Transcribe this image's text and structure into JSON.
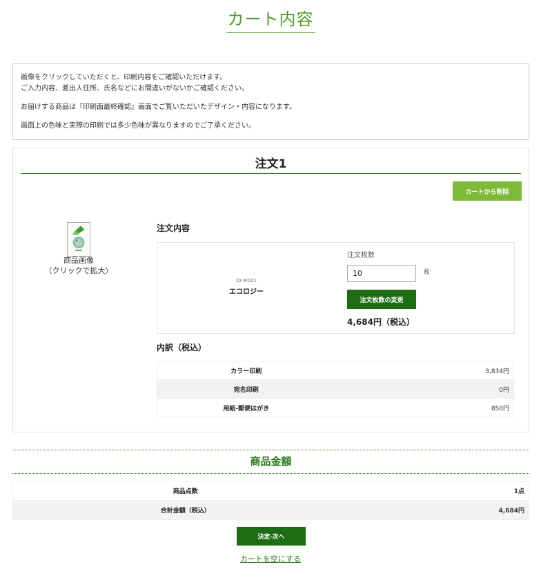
{
  "page": {
    "title": "カート内容"
  },
  "notice": {
    "line1": "画像をクリックしていただくと、印刷内容をご確認いただけます。",
    "line2": "ご入力内容、差出人住所、氏名などにお間違いがないかご確認ください。",
    "line3": "お届けする商品は『印刷面最終確認』画面でご覧いただいたデザイン・内容になります。",
    "line4": "画面上の色味と実際の印刷では多少色味が異なりますのでご了承ください。"
  },
  "order": {
    "title": "注文1",
    "delete_label": "カートから削除",
    "image_caption_1": "商品画像",
    "image_caption_2": "（クリックで拡大）",
    "contents_heading": "注文内容",
    "item_id": "ID:W001",
    "item_name": "エコロジー",
    "qty_label": "注文枚数",
    "qty_value": "10",
    "qty_unit": "枚",
    "qty_change_label": "注文枚数の変更",
    "subtotal": "4,684円（税込）",
    "breakdown_heading": "内訳（税込）",
    "breakdown": [
      {
        "label": "カラー印刷",
        "value": "3,834円"
      },
      {
        "label": "宛名印刷",
        "value": "0円"
      },
      {
        "label": "用紙-郵便はがき",
        "value": "850円"
      }
    ]
  },
  "totals": {
    "heading": "商品金額",
    "rows": [
      {
        "label": "商品点数",
        "value": "1点"
      },
      {
        "label": "合計金額（税込）",
        "value": "4,684円"
      }
    ]
  },
  "actions": {
    "next_label": "決定-次へ",
    "empty_cart_label": "カートを空にする"
  },
  "colors": {
    "accent_green": "#2a7a1a",
    "button_dark_green": "#1d6e12",
    "button_light_green": "#7fba3a",
    "title_green": "#4f9a2b"
  }
}
